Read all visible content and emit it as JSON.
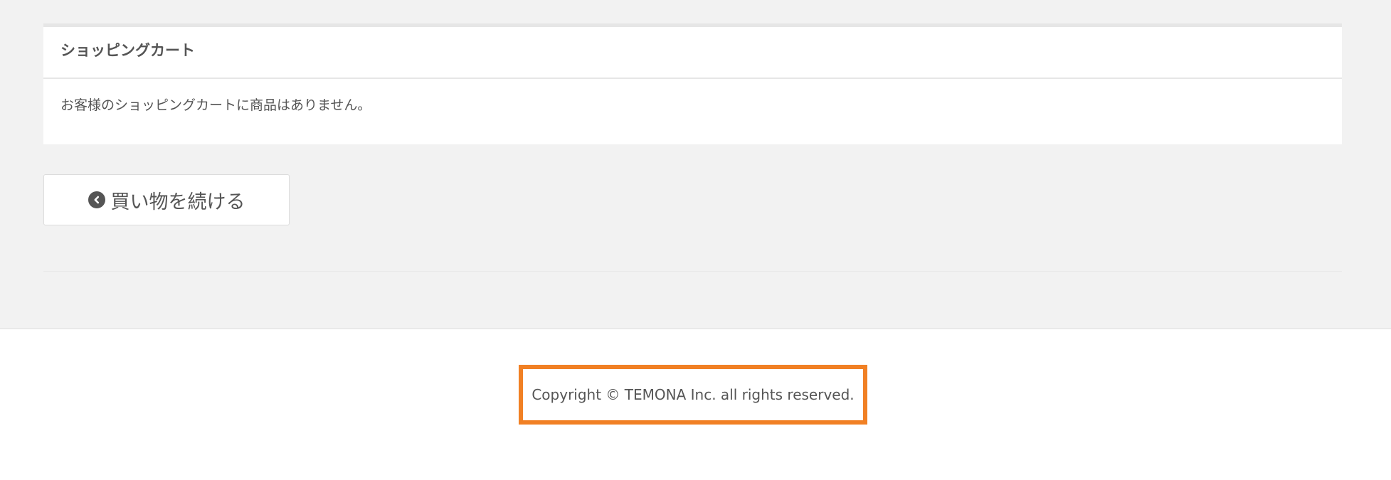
{
  "cart": {
    "title": "ショッピングカート",
    "empty_message": "お客様のショッピングカートに商品はありません。"
  },
  "continue_button": {
    "label": "買い物を続ける",
    "icon": "chevron-left-circle-icon"
  },
  "footer": {
    "copyright": "Copyright © TEMONA Inc. all rights reserved.",
    "highlight_color": "#f18024"
  }
}
